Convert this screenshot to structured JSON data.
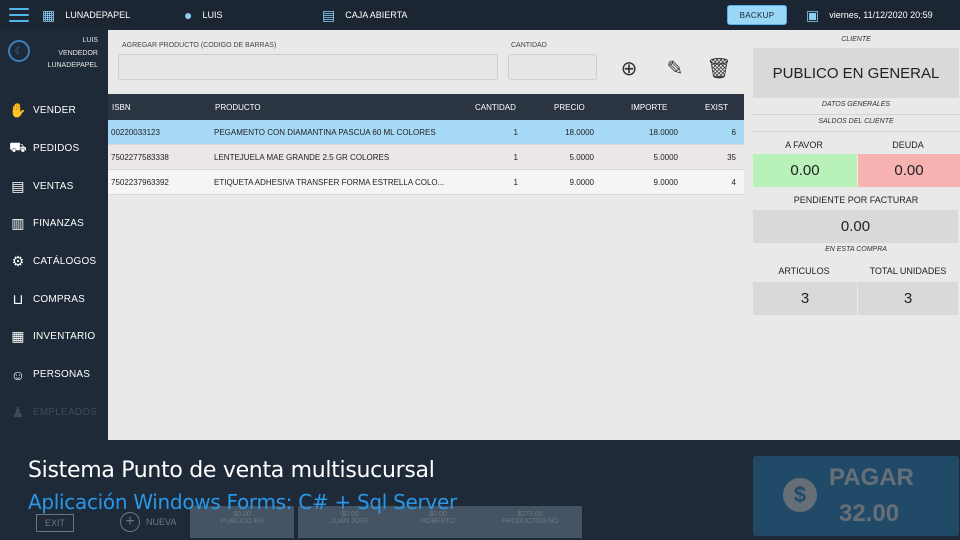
{
  "topbar": {
    "store": "LUNADEPAPEL",
    "user": "LUIS",
    "register_status": "CAJA ABIERTA",
    "backup_label": "BACKUP",
    "datetime": "viernes, 11/12/2020 20:59"
  },
  "sidebar": {
    "user_lines": [
      "LUIS",
      "VENDEDOR",
      "LUNADEPAPEL"
    ],
    "items": [
      {
        "label": "VENDER",
        "icon": "hand-icon"
      },
      {
        "label": "PEDIDOS",
        "icon": "truck-icon"
      },
      {
        "label": "VENTAS",
        "icon": "receipt-icon"
      },
      {
        "label": "FINANZAS",
        "icon": "finance-icon"
      },
      {
        "label": "CATÁLOGOS",
        "icon": "gear-icon"
      },
      {
        "label": "COMPRAS",
        "icon": "cart-icon"
      },
      {
        "label": "INVENTARIO",
        "icon": "inventory-icon"
      },
      {
        "label": "PERSONAS",
        "icon": "people-icon"
      },
      {
        "label": "EMPLEADOS",
        "icon": "employee-icon"
      }
    ]
  },
  "entry": {
    "product_label": "AGREGAR PRODUCTO (CODIGO DE BARRAS)",
    "quantity_label": "CANTIDAD"
  },
  "table": {
    "headers": [
      "ISBN",
      "PRODUCTO",
      "CANTIDAD",
      "PRECIO",
      "IMPORTE",
      "EXIST"
    ],
    "rows": [
      [
        "00220033123",
        "PEGAMENTO CON DIAMANTINA PASCUA 60 ML COLORES",
        "1",
        "18.0000",
        "18.0000",
        "6"
      ],
      [
        "7502277583338",
        "LENTEJUELA MAE GRANDE 2.5 GR COLORES",
        "1",
        "5.0000",
        "5.0000",
        "35"
      ],
      [
        "7502237963392",
        "ETIQUETA ADHESIVA TRANSFER FORMA ESTRELLA COLO...",
        "1",
        "9.0000",
        "9.0000",
        "4"
      ]
    ]
  },
  "client": {
    "title": "CLIENTE",
    "name": "PUBLICO EN GENERAL",
    "general": "DATOS GENERALES",
    "balances": "SALDOS DEL CLIENTE",
    "favor_label": "A FAVOR",
    "debt_label": "DEUDA",
    "favor_value": "0.00",
    "debt_value": "0.00",
    "pending_label": "PENDIENTE POR FACTURAR",
    "pending_value": "0.00",
    "this_purchase": "EN ESTA COMPRA",
    "articles_label": "ARTICULOS",
    "units_label": "TOTAL UNIDADES",
    "articles_value": "3",
    "units_value": "3"
  },
  "bottom": {
    "exit": "EXIT",
    "new": "NUEVA",
    "tabs": [
      {
        "top": "$0.00",
        "bottom": "PUBLICO EN"
      },
      {
        "top": "$0.00",
        "bottom": "JUAN JOSE"
      },
      {
        "top": "$0.00",
        "bottom": "ROBERTO"
      },
      {
        "top": "$273.00",
        "bottom": "PRODUCTOS NO"
      }
    ],
    "pay_label": "PAGAR",
    "pay_total": "32.00"
  },
  "caption": {
    "line1": "Sistema Punto de venta multisucursal",
    "line2": "Aplicación Windows Forms: C# + Sql Server"
  },
  "colors": {
    "selected_row": "#a6d9f6",
    "favor": "#b9f2b9",
    "debt": "#f7b3b1",
    "accent": "#2a98e8"
  }
}
